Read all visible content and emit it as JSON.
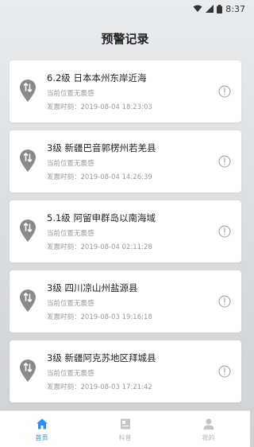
{
  "status_bar": {
    "time": "8:37"
  },
  "page": {
    "title": "预警记录"
  },
  "records": [
    {
      "title": "6.2级 日本本州东岸近海",
      "status": "当前位置无震感",
      "time": "发震时刻：2019-08-04 18:23:03"
    },
    {
      "title": "3级 新疆巴音郭楞州若羌县",
      "status": "当前位置无震感",
      "time": "发震时刻：2019-08-04 14:26:39"
    },
    {
      "title": "5.1级 阿留申群岛以南海域",
      "status": "当前位置无震感",
      "time": "发震时刻：2019-08-04 02:11:28"
    },
    {
      "title": "3级 四川凉山州盐源县",
      "status": "当前位置无震感",
      "time": "发震时刻：2019-08-03 19:16:18"
    },
    {
      "title": "3级 新疆阿克苏地区拜城县",
      "status": "当前位置无震感",
      "time": "发震时刻：2019-08-03 17:21:42"
    }
  ],
  "tabs": [
    {
      "label": "首页",
      "icon": "home-icon",
      "active": true
    },
    {
      "label": "科普",
      "icon": "book-icon",
      "active": false
    },
    {
      "label": "我的",
      "icon": "user-icon",
      "active": false
    }
  ],
  "colors": {
    "accent": "#2f8ff0",
    "pin": "#8a8a8a",
    "muted": "#9a9a9a"
  }
}
